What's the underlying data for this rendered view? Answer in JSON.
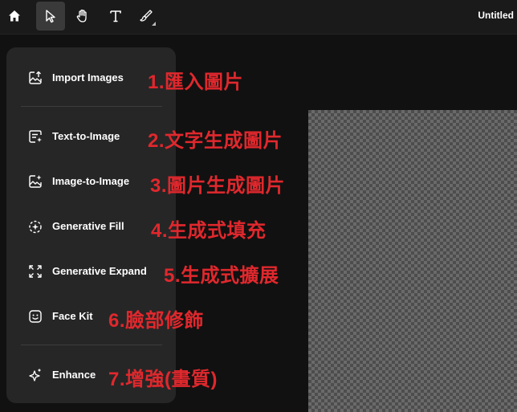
{
  "toolbar": {
    "tools": [
      {
        "name": "home",
        "icon": "home-icon"
      },
      {
        "name": "select",
        "icon": "cursor-icon",
        "active": true
      },
      {
        "name": "pan",
        "icon": "hand-icon"
      },
      {
        "name": "text",
        "icon": "text-icon"
      },
      {
        "name": "brush",
        "icon": "brush-icon"
      }
    ],
    "title": "Untitled"
  },
  "menu": {
    "items": [
      {
        "label": "Import Images",
        "icon": "image-upload-icon",
        "annotation": "1.匯入圖片"
      },
      {
        "label": "Text-to-Image",
        "icon": "text-sparkle-icon",
        "annotation": "2.文字生成圖片"
      },
      {
        "label": "Image-to-Image",
        "icon": "image-sparkle-icon",
        "annotation": "3.圖片生成圖片"
      },
      {
        "label": "Generative Fill",
        "icon": "generative-fill-icon",
        "annotation": "4.生成式填充"
      },
      {
        "label": "Generative Expand",
        "icon": "expand-icon",
        "annotation": "5.生成式擴展"
      },
      {
        "label": "Face Kit",
        "icon": "face-icon",
        "annotation": "6.臉部修飾"
      },
      {
        "label": "Enhance",
        "icon": "sparkles-icon",
        "annotation": "7.增強(畫質)"
      }
    ]
  },
  "colors": {
    "background": "#111111",
    "toolbar": "#1a1a1a",
    "menu": "#262626",
    "annotation": "#e0282d",
    "text": "#ffffff"
  }
}
